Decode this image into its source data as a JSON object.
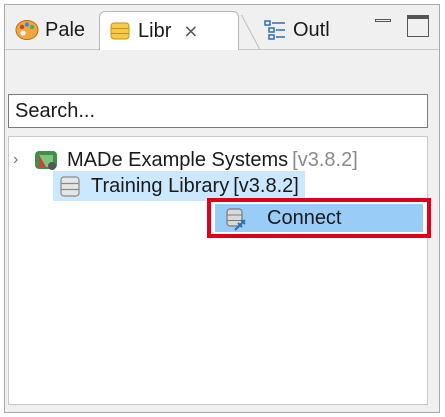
{
  "tabs": [
    {
      "label": "Pale",
      "icon": "palette-icon"
    },
    {
      "label": "Libr",
      "icon": "library-icon",
      "close": "⨯"
    },
    {
      "label": "Outl",
      "icon": "outline-icon"
    }
  ],
  "window_controls": {
    "minimize": "minimize-icon",
    "maximize": "maximize-icon"
  },
  "search": {
    "placeholder": "Search..."
  },
  "tree": [
    {
      "label": "MADe Example Systems",
      "version": "[v3.8.2]",
      "icon": "systems-icon",
      "expander": "›"
    },
    {
      "label": "Training Library",
      "version": "[v3.8.2]",
      "icon": "database-icon",
      "selected": true
    }
  ],
  "context_menu": {
    "items": [
      {
        "label": "Connect",
        "icon": "connect-icon"
      }
    ]
  },
  "colors": {
    "selection": "#cce8ff",
    "menu_highlight": "#99cdf7",
    "callout_border": "#e0001a"
  }
}
